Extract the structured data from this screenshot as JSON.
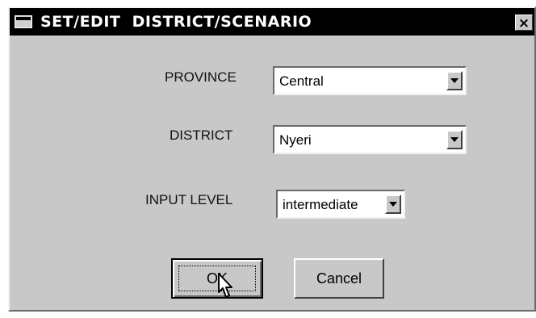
{
  "dialog": {
    "title": "SET/EDIT  DISTRICT/SCENARIO",
    "close_label": "×"
  },
  "fields": {
    "province": {
      "label": "PROVINCE",
      "value": "Central"
    },
    "district": {
      "label": "DISTRICT",
      "value": "Nyeri"
    },
    "input_level": {
      "label": "INPUT LEVEL",
      "value": "intermediate"
    }
  },
  "buttons": {
    "ok_label": "OK",
    "cancel_label": "Cancel"
  }
}
